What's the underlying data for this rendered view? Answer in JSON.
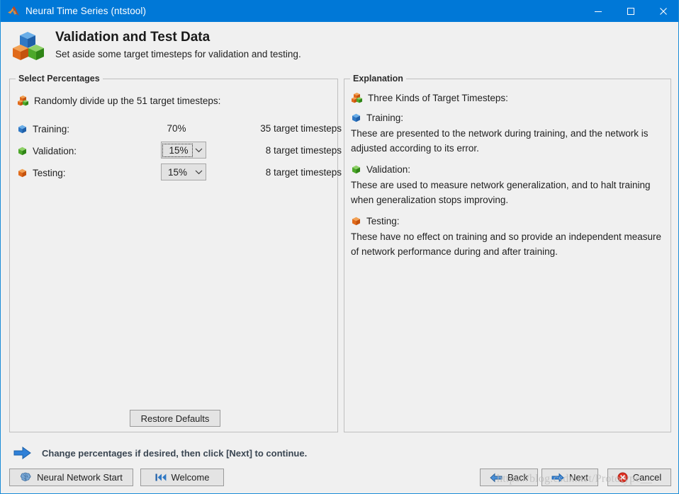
{
  "window": {
    "title": "Neural Time Series (ntstool)",
    "app_icon": "matlab-membrane-icon",
    "controls": {
      "minimize": "minimize-icon",
      "maximize": "maximize-icon",
      "close": "close-icon"
    },
    "titlebar_color": "#0078d7",
    "border_color": "#1a8cd8",
    "background": "#f0f0f0"
  },
  "header": {
    "icon": "three-cubes-icon",
    "title": "Validation and Test Data",
    "subtitle": "Set aside some target timesteps for validation and testing."
  },
  "left_panel": {
    "legend": "Select Percentages",
    "divide": {
      "icon": "three-cubes-small-icon",
      "text": "Randomly divide up the 51 target timesteps:"
    },
    "rows": [
      {
        "icon": "blue-cube-icon",
        "label": "Training:",
        "value": "70%",
        "control": "static",
        "count": "35 target timesteps"
      },
      {
        "icon": "green-cube-icon",
        "label": "Validation:",
        "value": "15%",
        "control": "combobox",
        "focused": true,
        "count": "8 target timesteps"
      },
      {
        "icon": "orange-cube-icon",
        "label": "Testing:",
        "value": "15%",
        "control": "combobox",
        "focused": false,
        "count": "8 target timesteps"
      }
    ],
    "restore_defaults_label": "Restore Defaults"
  },
  "right_panel": {
    "legend": "Explanation",
    "intro": {
      "icon": "three-cubes-small-icon",
      "text": "Three Kinds of Target Timesteps:"
    },
    "sections": [
      {
        "icon": "blue-cube-icon",
        "heading": "Training:",
        "body": "These are presented to the network during training, and the network is adjusted according to its error."
      },
      {
        "icon": "green-cube-icon",
        "heading": "Validation:",
        "body": "These are used to measure network generalization, and to halt training when generalization stops improving."
      },
      {
        "icon": "orange-cube-icon",
        "heading": "Testing:",
        "body": "These have no effect on training and so provide an independent measure of network performance during and after training."
      }
    ]
  },
  "status": {
    "icon": "blue-right-arrow-icon",
    "text": "Change percentages if desired, then click [Next] to continue."
  },
  "buttons": {
    "neural_network_start": {
      "label": "Neural Network Start",
      "icon": "brain-icon"
    },
    "welcome": {
      "label": "Welcome",
      "icon": "rewind-to-start-icon"
    },
    "back": {
      "label": "Back",
      "icon": "blue-left-arrow-icon"
    },
    "next": {
      "label": "Next",
      "icon": "blue-right-arrow-icon"
    },
    "cancel": {
      "label": "Cancel",
      "icon": "red-x-circle-icon"
    }
  },
  "watermark": {
    "text": "https://blog.csdn.net/Prototype__"
  }
}
